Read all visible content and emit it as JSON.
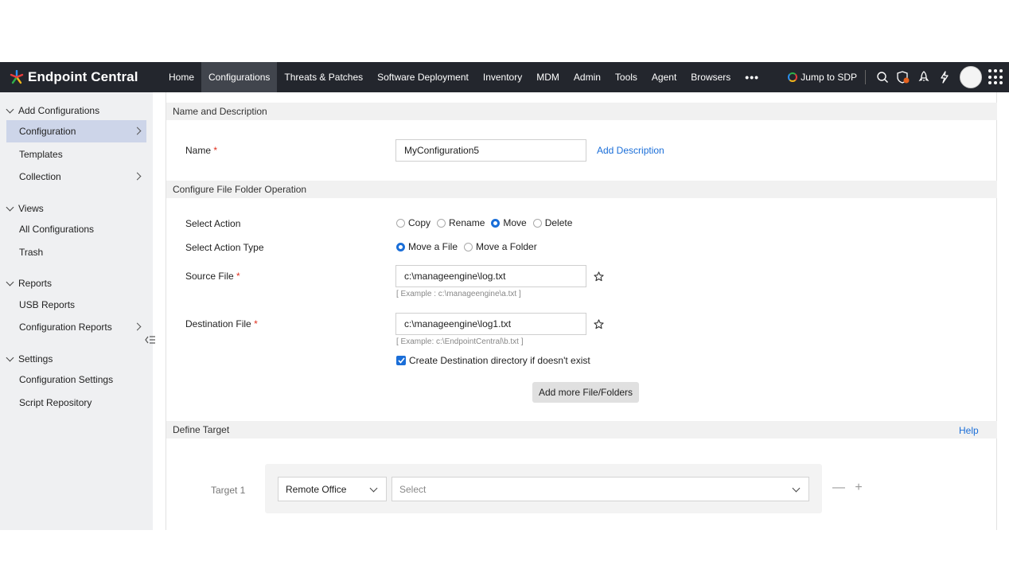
{
  "app": {
    "brand": "Endpoint Central",
    "brand_colors": [
      "#2d8ff0",
      "#e83c3c",
      "#f3b71b",
      "#2fb14a"
    ],
    "accent": "#1a6ed8"
  },
  "topnav": {
    "items": [
      "Home",
      "Configurations",
      "Threats & Patches",
      "Software Deployment",
      "Inventory",
      "MDM",
      "Admin",
      "Tools",
      "Agent",
      "Browsers"
    ],
    "active": "Configurations",
    "more": "•••",
    "jump_label": "Jump to SDP",
    "icons": [
      "search-icon",
      "shield-icon",
      "rocket-icon",
      "lightning-icon",
      "avatar",
      "apps-grid-icon"
    ]
  },
  "sidebar": {
    "sections": [
      {
        "title": "Add Configurations",
        "items": [
          {
            "label": "Configuration",
            "active": true,
            "arrow": true
          },
          {
            "label": "Templates"
          },
          {
            "label": "Collection",
            "arrow": true
          }
        ]
      },
      {
        "title": "Views",
        "items": [
          {
            "label": "All Configurations"
          },
          {
            "label": "Trash"
          }
        ]
      },
      {
        "title": "Reports",
        "items": [
          {
            "label": "USB Reports"
          },
          {
            "label": "Configuration Reports",
            "arrow": true
          }
        ]
      },
      {
        "title": "Settings",
        "items": [
          {
            "label": "Configuration Settings"
          },
          {
            "label": "Script Repository"
          }
        ]
      }
    ]
  },
  "form": {
    "section_name": "Name and Description",
    "name_label": "Name",
    "name_value": "MyConfiguration5",
    "add_description": "Add Description",
    "section_op": "Configure File Folder Operation",
    "action_label": "Select Action",
    "actions": [
      {
        "label": "Copy",
        "selected": false
      },
      {
        "label": "Rename",
        "selected": false
      },
      {
        "label": "Move",
        "selected": true
      },
      {
        "label": "Delete",
        "selected": false
      }
    ],
    "action_type_label": "Select Action Type",
    "action_types": [
      {
        "label": "Move a File",
        "selected": true
      },
      {
        "label": "Move a Folder",
        "selected": false
      }
    ],
    "source_label": "Source File",
    "source_value": "c:\\manageengine\\log.txt",
    "source_hint": "[ Example : c:\\manageengine\\a.txt ]",
    "dest_label": "Destination File",
    "dest_value": "c:\\manageengine\\log1.txt",
    "dest_hint": "[ Example: c:\\EndpointCentral\\b.txt ]",
    "create_dir_label": "Create Destination directory if doesn't exist",
    "create_dir_checked": true,
    "add_more": "Add more File/Folders",
    "required_mark": "*"
  },
  "target": {
    "section": "Define Target",
    "help": "Help",
    "row_label": "Target 1",
    "type_value": "Remote Office",
    "select_placeholder": "Select",
    "remove": "—",
    "add": "+"
  }
}
